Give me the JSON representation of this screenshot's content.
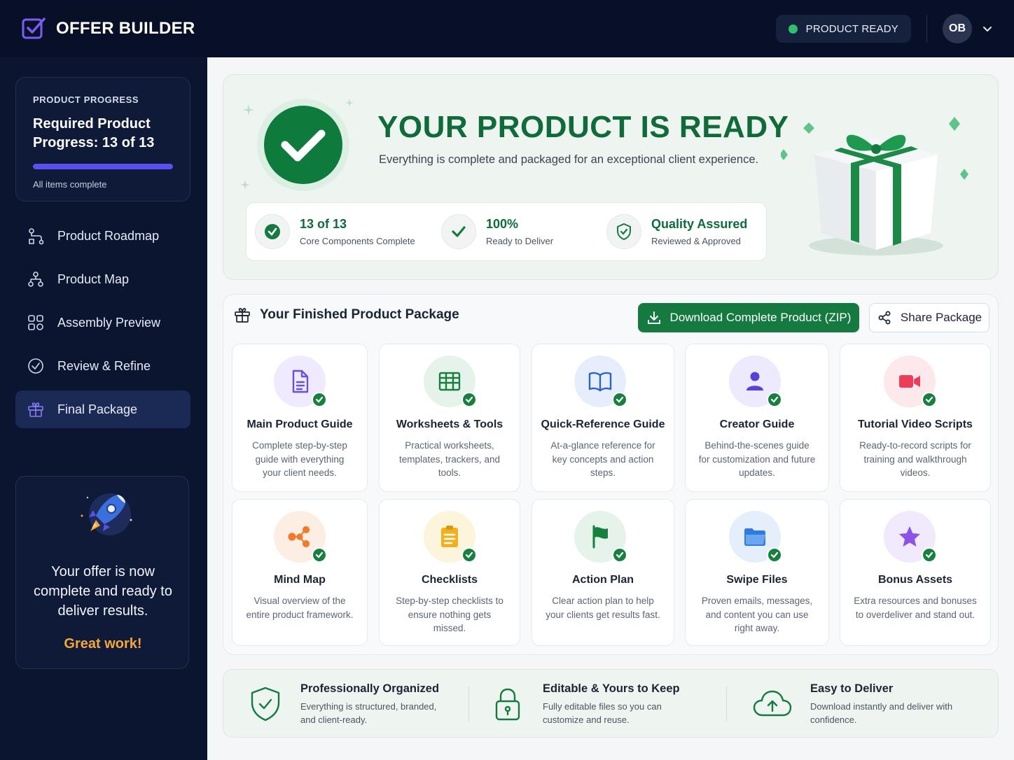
{
  "app": {
    "title": "OFFER BUILDER",
    "status": "PRODUCT READY",
    "avatar_initials": "OB"
  },
  "sidebar": {
    "progress": {
      "label": "PRODUCT PROGRESS",
      "title": "Required Product Progress: 13 of 13",
      "completed": 13,
      "total": 13,
      "subtitle": "All items complete"
    },
    "items": [
      {
        "label": "Product Roadmap",
        "icon": "roadmap-icon",
        "active": false
      },
      {
        "label": "Product Map",
        "icon": "map-icon",
        "active": false
      },
      {
        "label": "Assembly Preview",
        "icon": "assembly-icon",
        "active": false
      },
      {
        "label": "Review & Refine",
        "icon": "check-circle-icon",
        "active": false
      },
      {
        "label": "Final Package",
        "icon": "gift-icon",
        "active": true
      }
    ],
    "promo": {
      "text": "Your offer is now complete and ready to deliver results.",
      "highlight": "Great work!"
    }
  },
  "hero": {
    "title": "YOUR PRODUCT IS READY",
    "subtitle": "Everything is complete and packaged for an exceptional client experience.",
    "stats": [
      {
        "value": "13 of 13",
        "label": "Core Components Complete"
      },
      {
        "value": "100%",
        "label": "Ready to Deliver"
      },
      {
        "value": "Quality Assured",
        "label": "Reviewed & Approved"
      }
    ]
  },
  "package": {
    "title": "Your Finished Product Package",
    "download_label": "Download Complete Product (ZIP)",
    "share_label": "Share Package",
    "items": [
      {
        "title": "Main Product Guide",
        "desc": "Complete step-by-step guide with everything your client needs.",
        "icon": "document-icon",
        "color": "#6b4fe0"
      },
      {
        "title": "Worksheets & Tools",
        "desc": "Practical worksheets, templates, trackers, and tools.",
        "icon": "spreadsheet-icon",
        "color": "#17803f"
      },
      {
        "title": "Quick-Reference Guide",
        "desc": "At-a-glance reference for key concepts and action steps.",
        "icon": "book-icon",
        "color": "#2a63c9"
      },
      {
        "title": "Creator Guide",
        "desc": "Behind-the-scenes guide for customization and future updates.",
        "icon": "user-icon",
        "color": "#5a3fd8"
      },
      {
        "title": "Tutorial Video Scripts",
        "desc": "Ready-to-record scripts for training and walkthrough videos.",
        "icon": "video-icon",
        "color": "#ec3d5a"
      },
      {
        "title": "Mind Map",
        "desc": "Visual overview of the entire product framework.",
        "icon": "mind-map-icon",
        "color": "#f07b2a"
      },
      {
        "title": "Checklists",
        "desc": "Step-by-step checklists to ensure nothing gets missed.",
        "icon": "checklist-icon",
        "color": "#f2b01e"
      },
      {
        "title": "Action Plan",
        "desc": "Clear action plan to help your clients get results fast.",
        "icon": "flag-icon",
        "color": "#17803f"
      },
      {
        "title": "Swipe Files",
        "desc": "Proven emails, messages, and content you can use right away.",
        "icon": "folder-icon",
        "color": "#2f7be0"
      },
      {
        "title": "Bonus Assets",
        "desc": "Extra resources and bonuses to overdeliver and stand out.",
        "icon": "star-icon",
        "color": "#8a55e6"
      }
    ]
  },
  "features": [
    {
      "title": "Professionally Organized",
      "desc": "Everything is structured, branded, and client-ready.",
      "icon": "shield-check-icon"
    },
    {
      "title": "Editable & Yours to Keep",
      "desc": "Fully editable files so you can customize and reuse.",
      "icon": "lock-icon"
    },
    {
      "title": "Easy to Deliver",
      "desc": "Download instantly and deliver with confidence.",
      "icon": "cloud-upload-icon"
    }
  ],
  "colors": {
    "accent_green": "#157a3f",
    "sidebar_bg": "#0b1530",
    "progress_fill": "#5a4ff0",
    "highlight_orange": "#f4a638"
  }
}
